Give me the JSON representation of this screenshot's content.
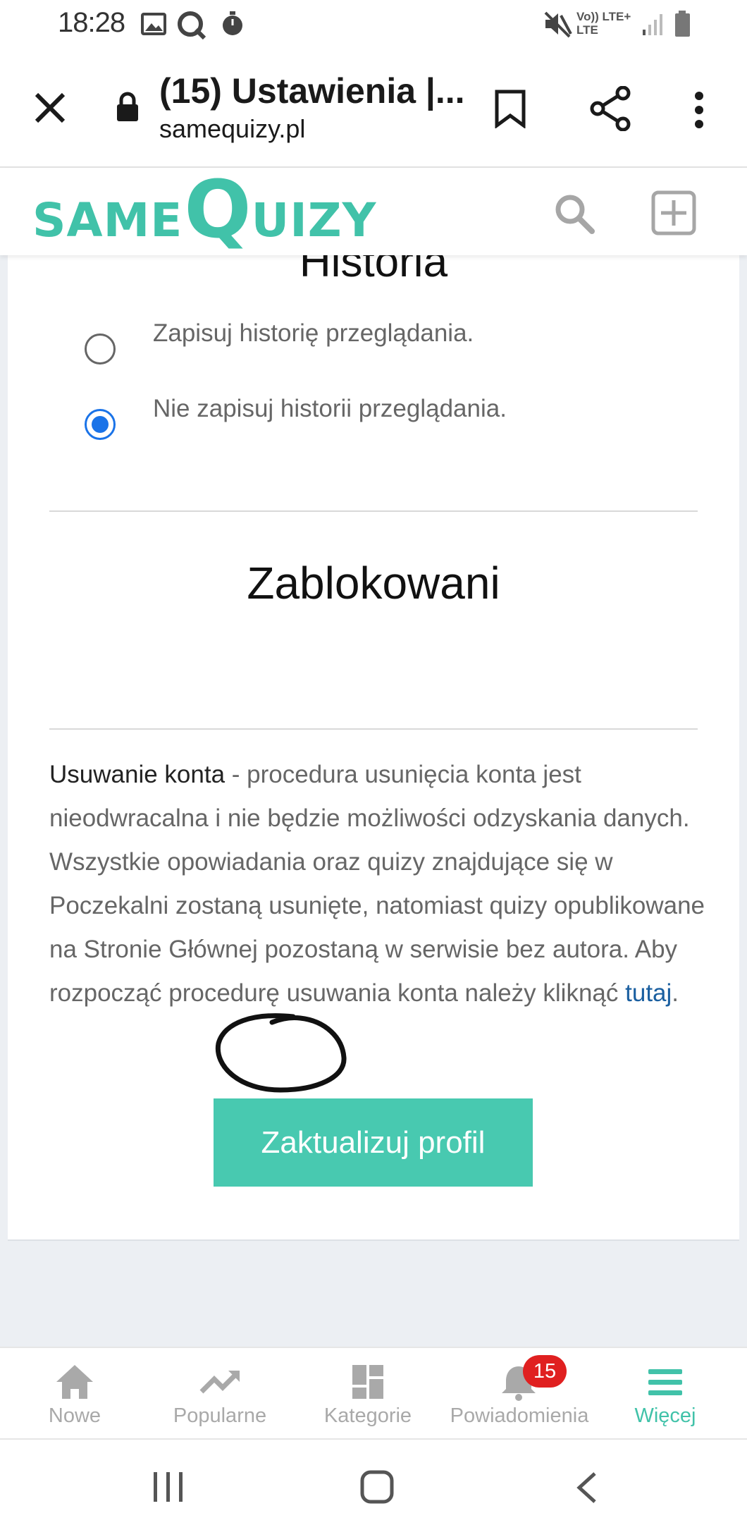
{
  "status_bar": {
    "time": "18:28",
    "network_top": "Vo)) LTE+",
    "network_bottom": "LTE"
  },
  "browser": {
    "title": "(15) Ustawienia |...",
    "url": "samequizy.pl"
  },
  "site": {
    "logo": {
      "part1": "SAME",
      "part2": "Q",
      "part3": "UIZY"
    }
  },
  "history": {
    "title": "Historia",
    "options": [
      {
        "label": "Zapisuj historię przeglądania.",
        "checked": false
      },
      {
        "label": "Nie zapisuj historii przeglądania.",
        "checked": true
      }
    ]
  },
  "blocked": {
    "title": "Zablokowani"
  },
  "delete_account": {
    "heading": "Usuwanie konta",
    "text": " - procedura usunięcia konta jest nieodwracalna i nie będzie możliwości odzyskania danych. Wszystkie opowiadania oraz quizy znajdujące się w Poczekalni zostaną usunięte, natomiast quizy opublikowane na Stronie Głównej pozostaną w serwisie bez autora. Aby rozpocząć procedurę usuwania konta należy kliknąć ",
    "link": "tutaj",
    "end": "."
  },
  "update_button": "Zaktualizuj profil",
  "bottom_nav": {
    "items": [
      {
        "label": "Nowe",
        "icon": "home-icon"
      },
      {
        "label": "Popularne",
        "icon": "trending-icon"
      },
      {
        "label": "Kategorie",
        "icon": "grid-icon"
      },
      {
        "label": "Powiadomienia",
        "icon": "bell-icon"
      },
      {
        "label": "Więcej",
        "icon": "menu-icon",
        "active": true
      }
    ],
    "notification_count": "15"
  },
  "colors": {
    "accent": "#41c2a9",
    "button": "#48c9b0",
    "link": "#1a5fa0",
    "radio": "#1a73e8",
    "badge": "#e02020"
  }
}
